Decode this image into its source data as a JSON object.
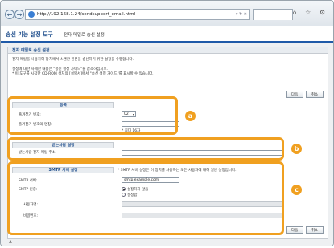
{
  "browser": {
    "url": "http://192.168.1.24/sendsupport_email.html",
    "nav_back": "←",
    "nav_forward": "→",
    "addr_buttons": "▾ ↻ ✕",
    "window_icons": "⌂ ☆ ⚙"
  },
  "header": {
    "app_title": "송신 기능 설정 도구",
    "subtitle": "전자 메일로 송신 설정"
  },
  "panel": {
    "title": "전자 메일로 송신 설정",
    "desc_line1": "전자 메일을 사용하여 장치에서 스캔한 원본을 송신하기 위한 설정을 수행합니다.",
    "desc_line2": "설정에 대한 자세한 내용은 \"송신 설정 가이드\"를 참조하십시오.",
    "desc_line3": "* 이 도구를 시작한 CD-ROM 설치의 [설명서]에서 \"송신 설정 가이드\"를 표시할 수 있습니다.",
    "next_label": "다음",
    "cancel_label": "취소"
  },
  "section_a": {
    "header": "등록",
    "favorite_label": "즐겨찾기 번호:",
    "favorite_value": "02",
    "favname_label": "즐겨찾기 번호의 명칭:",
    "favname_value": "",
    "max_note": "* 최대 16자"
  },
  "section_b": {
    "header": "받는사람 설정",
    "recipient_label": "받는사람 전자 메일 주소:",
    "recipient_value": ""
  },
  "section_c": {
    "header": "SMTP 서버 설정",
    "note": "* SMTP 서버 설정은 이 장치를 사용하는 모든 사용자에 대해 일반 설정입니다.",
    "server_label": "SMTP 서버:",
    "server_value": "smtp.example.com",
    "auth_label": "SMTP 인증:",
    "auth_option1": "설정하지 않음",
    "auth_option2": "설정함",
    "user_label": "사용자명:",
    "user_value": "",
    "password_label": "비밀번호:",
    "password_value": ""
  },
  "badges": {
    "a": "a",
    "b": "b",
    "c": "c"
  },
  "footer": {
    "top_link": "▲"
  },
  "colors": {
    "accent": "#1f5aa8",
    "highlight": "#f0a020"
  }
}
